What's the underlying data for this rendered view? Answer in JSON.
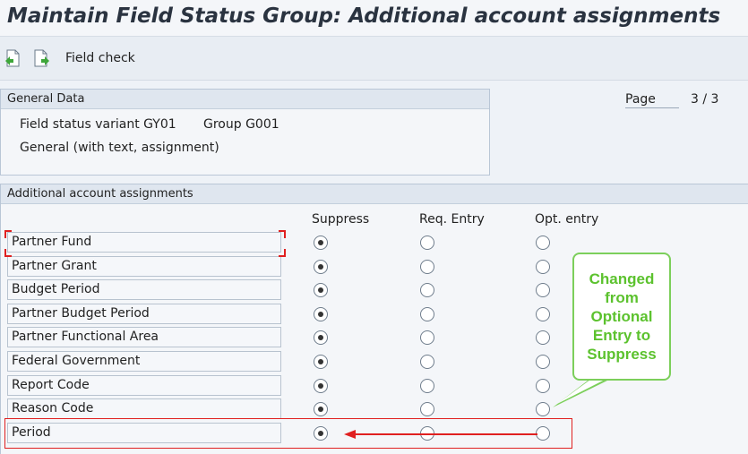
{
  "title": "Maintain Field Status Group: Additional account assignments",
  "toolbar": {
    "prev_icon": "previous-page-icon",
    "next_icon": "next-page-icon",
    "field_check_label": "Field check"
  },
  "general_data": {
    "header": "General Data",
    "variant_text": "Field status variant GY01",
    "group_text": "Group G001",
    "description": "General (with text, assignment)"
  },
  "page": {
    "label": "Page",
    "value": "3 / 3"
  },
  "assignments": {
    "header": "Additional account assignments",
    "columns": {
      "suppress": "Suppress",
      "req_entry": "Req. Entry",
      "opt_entry": "Opt. entry"
    },
    "rows": [
      {
        "label": "Partner Fund",
        "selected": "suppress"
      },
      {
        "label": "Partner Grant",
        "selected": "suppress"
      },
      {
        "label": "Budget Period",
        "selected": "suppress"
      },
      {
        "label": "Partner Budget Period",
        "selected": "suppress"
      },
      {
        "label": "Partner Functional Area",
        "selected": "suppress"
      },
      {
        "label": "Federal Government",
        "selected": "suppress"
      },
      {
        "label": "Report Code",
        "selected": "suppress"
      },
      {
        "label": "Reason Code",
        "selected": "suppress"
      },
      {
        "label": "Period",
        "selected": "suppress"
      }
    ]
  },
  "callout": {
    "lines": [
      "Changed",
      "from",
      "Optional",
      "Entry to",
      "Suppress"
    ]
  },
  "colors": {
    "annotation_red": "#e02020",
    "callout_green": "#5cc22e"
  }
}
